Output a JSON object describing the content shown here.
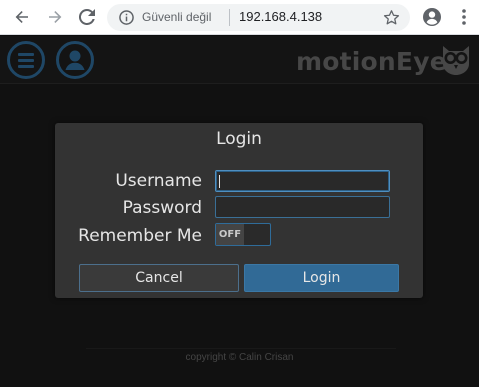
{
  "browser": {
    "back_icon": "arrow-left-icon",
    "forward_icon": "arrow-right-icon",
    "reload_icon": "reload-icon",
    "security_label": "Güvenli değil",
    "url": "192.168.4.138",
    "bookmark_icon": "star-icon",
    "profile_icon": "account-circle-icon",
    "menu_icon": "more-vertical-icon"
  },
  "app": {
    "brand": "motionEye",
    "menu_icon": "hamburger-menu-icon",
    "user_icon": "user-icon",
    "logo_icon": "owl-logo-icon",
    "copyright": "copyright © Calin Crisan"
  },
  "login": {
    "title": "Login",
    "username_label": "Username",
    "username_value": "",
    "password_label": "Password",
    "password_value": "",
    "remember_label": "Remember Me",
    "remember_state": "OFF",
    "cancel_label": "Cancel",
    "login_label": "Login"
  },
  "colors": {
    "accent": "#316a96",
    "header_icon_ring": "#1f4766",
    "dialog_bg": "#333333",
    "page_bg": "#111111"
  }
}
